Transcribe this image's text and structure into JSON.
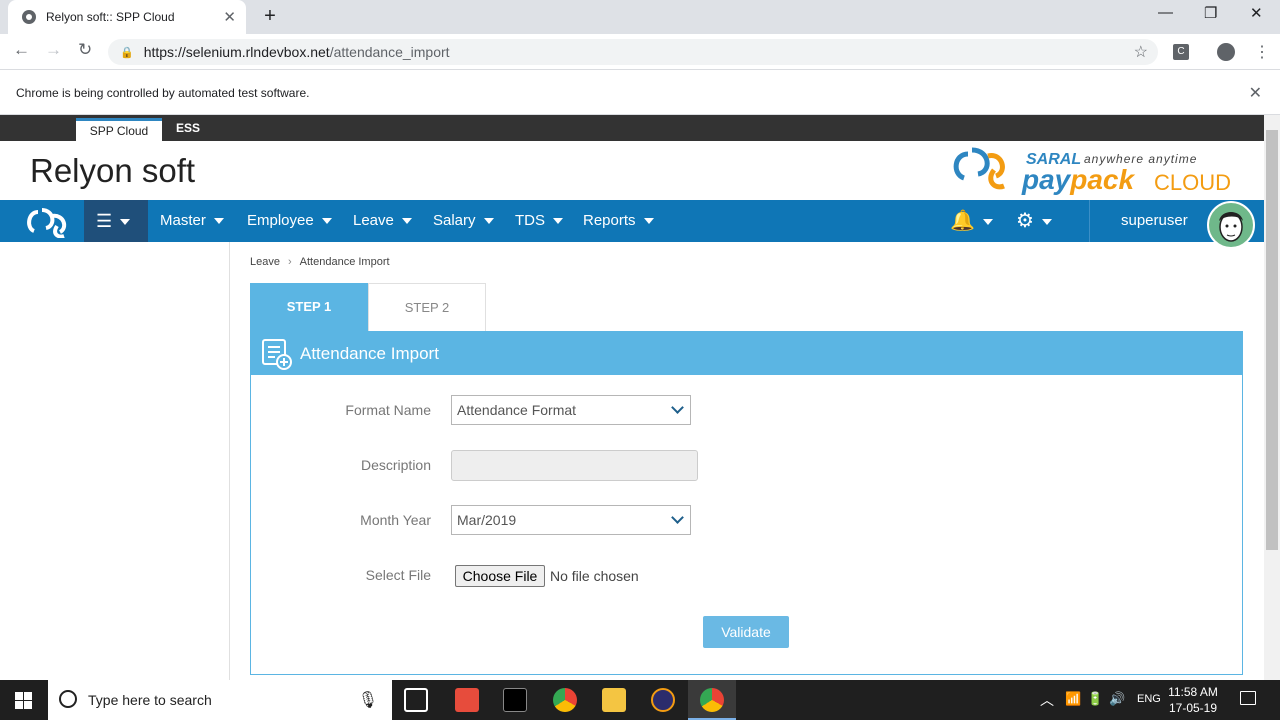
{
  "browser": {
    "tab_title": "Relyon soft:: SPP Cloud",
    "url_host": "https://selenium.rlndevbox.net",
    "url_path": "/attendance_import",
    "infobar_text": "Chrome is being controlled by automated test software."
  },
  "app": {
    "top_tabs": [
      "SPP Cloud",
      "ESS"
    ],
    "company_name": "Relyon soft",
    "logo": {
      "saral": "SARAL",
      "tagline": "anywhere anytime",
      "pay": "pay",
      "pack": "pack",
      "cloud": "CLOUD"
    },
    "nav": [
      "Master",
      "Employee",
      "Leave",
      "Salary",
      "TDS",
      "Reports"
    ],
    "username": "superuser"
  },
  "breadcrumb": [
    "Leave",
    "Attendance Import"
  ],
  "steps": [
    "STEP 1",
    "STEP 2"
  ],
  "panel_title": "Attendance Import",
  "form": {
    "format_label": "Format Name",
    "format_value": "Attendance Format",
    "description_label": "Description",
    "description_value": "",
    "month_label": "Month Year",
    "month_value": "Mar/2019",
    "file_label": "Select File",
    "choose_button": "Choose File",
    "file_status": "No file chosen",
    "validate_button": "Validate"
  },
  "taskbar": {
    "search_placeholder": "Type here to search",
    "lang": "ENG",
    "time": "11:58 AM",
    "date": "17-05-19"
  },
  "colors": {
    "nav_blue": "#0f76b6",
    "panel_blue": "#5bb5e3",
    "accent_orange": "#f39c12"
  }
}
